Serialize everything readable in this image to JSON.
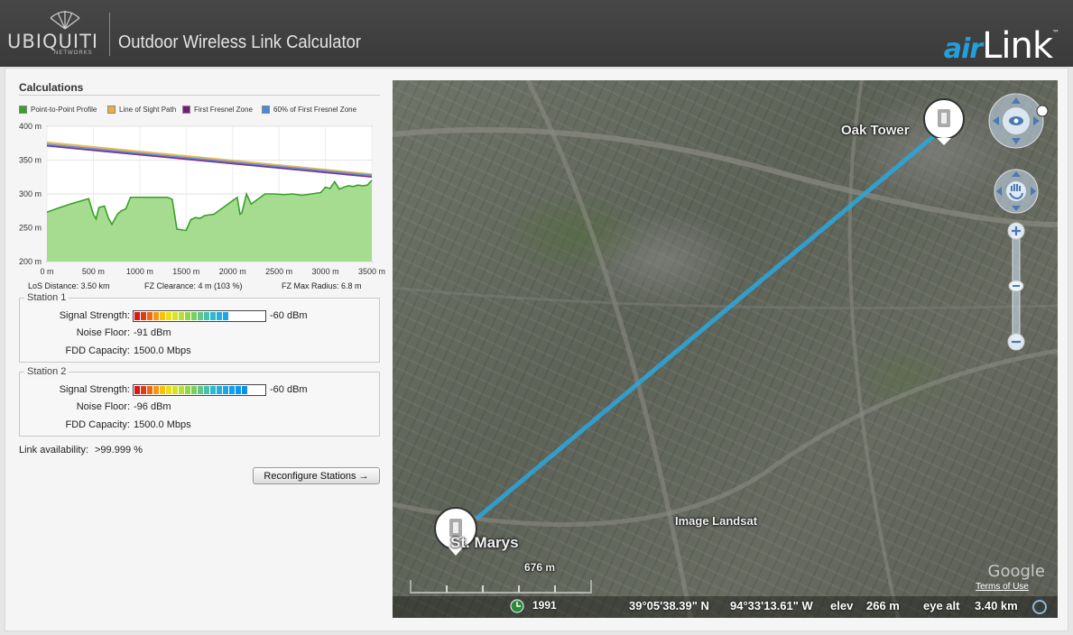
{
  "header": {
    "brand": "UBIQUITI",
    "brand_sub": "NETWORKS",
    "title": "Outdoor Wireless Link Calculator",
    "product_air": "air",
    "product_link": "Link",
    "product_tm": "™"
  },
  "calculations": {
    "title": "Calculations",
    "legend": [
      {
        "label": "Point-to-Point Profile",
        "color": "#3aa02a"
      },
      {
        "label": "Line of Sight Path",
        "color": "#e8b040"
      },
      {
        "label": "First Fresnel Zone",
        "color": "#7a1a78"
      },
      {
        "label": "60% of First Fresnel Zone",
        "color": "#4a8ad8"
      }
    ],
    "stats": {
      "los_distance": "LoS Distance: 3.50 km",
      "fz_clearance": "FZ Clearance: 4 m  (103 %)",
      "fz_max_radius": "FZ Max Radius: 6.8 m"
    }
  },
  "chart_data": {
    "type": "area",
    "title": "",
    "xlabel": "",
    "ylabel": "",
    "xlim": [
      0,
      3500
    ],
    "ylim": [
      200,
      400
    ],
    "x_ticks": [
      "0 m",
      "500 m",
      "1000 m",
      "1500 m",
      "2000 m",
      "2500 m",
      "3000 m",
      "3500 m"
    ],
    "y_ticks": [
      "400 m",
      "350 m",
      "300 m",
      "250 m",
      "200 m"
    ],
    "grid": true,
    "series": [
      {
        "name": "Point-to-Point Profile",
        "x": [
          0,
          100,
          250,
          450,
          500,
          530,
          560,
          620,
          660,
          700,
          760,
          800,
          850,
          900,
          950,
          1000,
          1100,
          1200,
          1300,
          1350,
          1400,
          1450,
          1500,
          1550,
          1600,
          1650,
          1700,
          1800,
          1900,
          2000,
          2050,
          2080,
          2100,
          2150,
          2200,
          2250,
          2350,
          2450,
          2550,
          2650,
          2750,
          2850,
          2950,
          3000,
          3050,
          3100,
          3150,
          3200,
          3250,
          3300,
          3350,
          3400,
          3450,
          3500
        ],
        "y": [
          273,
          278,
          285,
          293,
          270,
          263,
          280,
          282,
          265,
          255,
          270,
          275,
          278,
          295,
          295,
          295,
          295,
          295,
          295,
          292,
          248,
          247,
          246,
          262,
          265,
          264,
          268,
          270,
          280,
          290,
          295,
          270,
          272,
          300,
          285,
          290,
          300,
          300,
          299,
          300,
          298,
          300,
          302,
          310,
          308,
          318,
          307,
          310,
          312,
          311,
          313,
          312,
          313,
          320
        ]
      },
      {
        "name": "Line of Sight Path",
        "x": [
          0,
          3500
        ],
        "y": [
          376,
          329
        ]
      },
      {
        "name": "First Fresnel Zone",
        "x": [
          0,
          3500
        ],
        "y": [
          371,
          325
        ]
      },
      {
        "name": "60% of First Fresnel Zone",
        "x": [
          0,
          3500
        ],
        "y": [
          373,
          327
        ]
      }
    ]
  },
  "stations": [
    {
      "title": "Station 1",
      "signal_label": "Signal Strength:",
      "signal_value": "-60 dBm",
      "signal_level": 0.85,
      "noise_label": "Noise Floor:",
      "noise_value": "-91 dBm",
      "capacity_label": "FDD Capacity:",
      "capacity_value": "1500.0 Mbps"
    },
    {
      "title": "Station 2",
      "signal_label": "Signal Strength:",
      "signal_value": "-60 dBm",
      "signal_level": 1.0,
      "noise_label": "Noise Floor:",
      "noise_value": "-96 dBm",
      "capacity_label": "FDD Capacity:",
      "capacity_value": "1500.0 Mbps"
    }
  ],
  "link": {
    "availability_label": "Link availability:",
    "availability_value": ">99.999 %",
    "reconfigure_label": "Reconfigure Stations →"
  },
  "map": {
    "station_a": "Oak Tower",
    "station_b": "St. Marys",
    "image_credit": "Image Landsat",
    "scale": "676 m",
    "year": "1991",
    "latitude": "39°05'38.39\" N",
    "longitude": "94°33'13.61\" W",
    "elev_label": "elev",
    "elev_value": "266 m",
    "eye_alt_label": "eye alt",
    "eye_alt_value": "3.40 km",
    "google": "Google",
    "terms": "Terms of Use",
    "link_color": "#2aa8e0",
    "north": "N"
  },
  "meter_colors": [
    "#d81818",
    "#e43a12",
    "#ee6a10",
    "#f49a10",
    "#f8c010",
    "#f0dc18",
    "#d8e420",
    "#b8e030",
    "#90d840",
    "#78d060",
    "#60c888",
    "#48c0b0",
    "#30b8d0",
    "#20b0e0",
    "#18a8e8",
    "#10a0f0",
    "#0898f0",
    "#0890ec"
  ]
}
